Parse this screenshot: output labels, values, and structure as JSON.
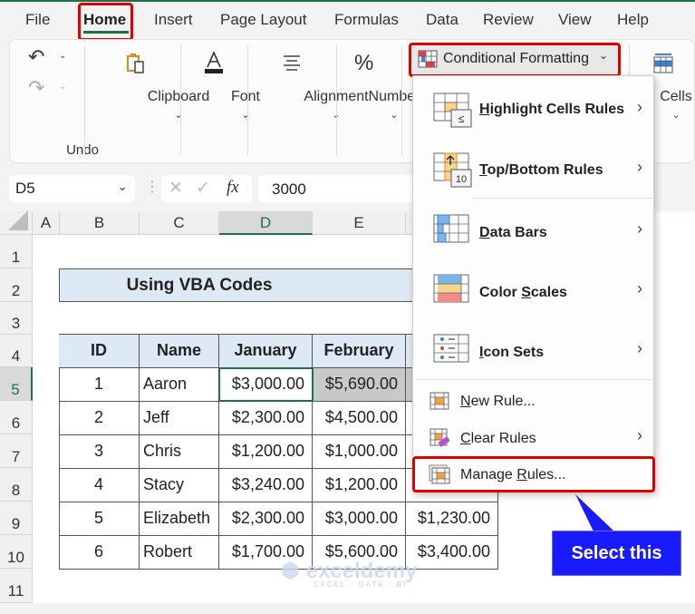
{
  "menu_tabs": [
    "File",
    "Home",
    "Insert",
    "Page Layout",
    "Formulas",
    "Data",
    "Review",
    "View",
    "Help"
  ],
  "active_tab": "Home",
  "ribbon": {
    "undo_label": "Undo",
    "groups": [
      "Clipboard",
      "Font",
      "Alignment",
      "Number"
    ],
    "conditional_formatting_label": "Conditional Formatting",
    "cells_label": "Cells"
  },
  "formula_bar": {
    "name_box": "D5",
    "cancel_icon": "✕",
    "enter_icon": "✓",
    "fx_label": "fx",
    "formula_value": "3000"
  },
  "sheet": {
    "columns": [
      "A",
      "B",
      "C",
      "D",
      "E"
    ],
    "selected_column": "D",
    "rows": [
      "1",
      "2",
      "3",
      "4",
      "5",
      "6",
      "7",
      "8",
      "9",
      "10",
      "11"
    ],
    "selected_row": "5",
    "title": "Using VBA Codes",
    "table_headers": [
      "ID",
      "Name",
      "January",
      "February"
    ],
    "table_rows": [
      {
        "id": "1",
        "name": "Aaron",
        "january": "$3,000.00",
        "february": "$5,690.00",
        "march": ""
      },
      {
        "id": "2",
        "name": "Jeff",
        "january": "$2,300.00",
        "february": "$4,500.00",
        "march": ""
      },
      {
        "id": "3",
        "name": "Chris",
        "january": "$1,200.00",
        "february": "$1,000.00",
        "march": ""
      },
      {
        "id": "4",
        "name": "Stacy",
        "january": "$3,240.00",
        "february": "$1,200.00",
        "march": ""
      },
      {
        "id": "5",
        "name": "Elizabeth",
        "january": "$2,300.00",
        "february": "$3,000.00",
        "march": "$1,230.00"
      },
      {
        "id": "6",
        "name": "Robert",
        "january": "$1,700.00",
        "february": "$5,600.00",
        "march": "$3,400.00"
      }
    ]
  },
  "dropdown": {
    "items": [
      {
        "label": "Highlight Cells Rules",
        "accel": "H",
        "rest": "ighlight Cells Rules",
        "has_submenu": true
      },
      {
        "label": "Top/Bottom Rules",
        "accel": "T",
        "rest": "op/Bottom Rules",
        "has_submenu": true
      },
      {
        "label": "Data Bars",
        "accel": "D",
        "rest": "ata Bars",
        "has_submenu": true
      },
      {
        "label": "Color Scales",
        "pre": "Color ",
        "accel": "S",
        "rest": "cales",
        "has_submenu": true
      },
      {
        "label": "Icon Sets",
        "accel": "I",
        "rest": "con Sets",
        "has_submenu": true
      },
      {
        "label": "New Rule...",
        "accel": "N",
        "rest": "ew Rule...",
        "has_submenu": false
      },
      {
        "label": "Clear Rules",
        "accel": "C",
        "rest": "lear Rules",
        "has_submenu": true
      },
      {
        "label": "Manage Rules...",
        "pre": "Manage ",
        "accel": "R",
        "rest": "ules...",
        "has_submenu": false
      }
    ],
    "submenu_arrow": "›"
  },
  "callout": {
    "text": "Select this",
    "color": "#1a1aff"
  },
  "watermark": {
    "brand": "exceldemy",
    "tagline": "EXCEL · DATA · BI"
  },
  "colors": {
    "accent_green": "#1e7145",
    "highlight_red": "#e00000",
    "header_fill": "#dde9f5"
  }
}
